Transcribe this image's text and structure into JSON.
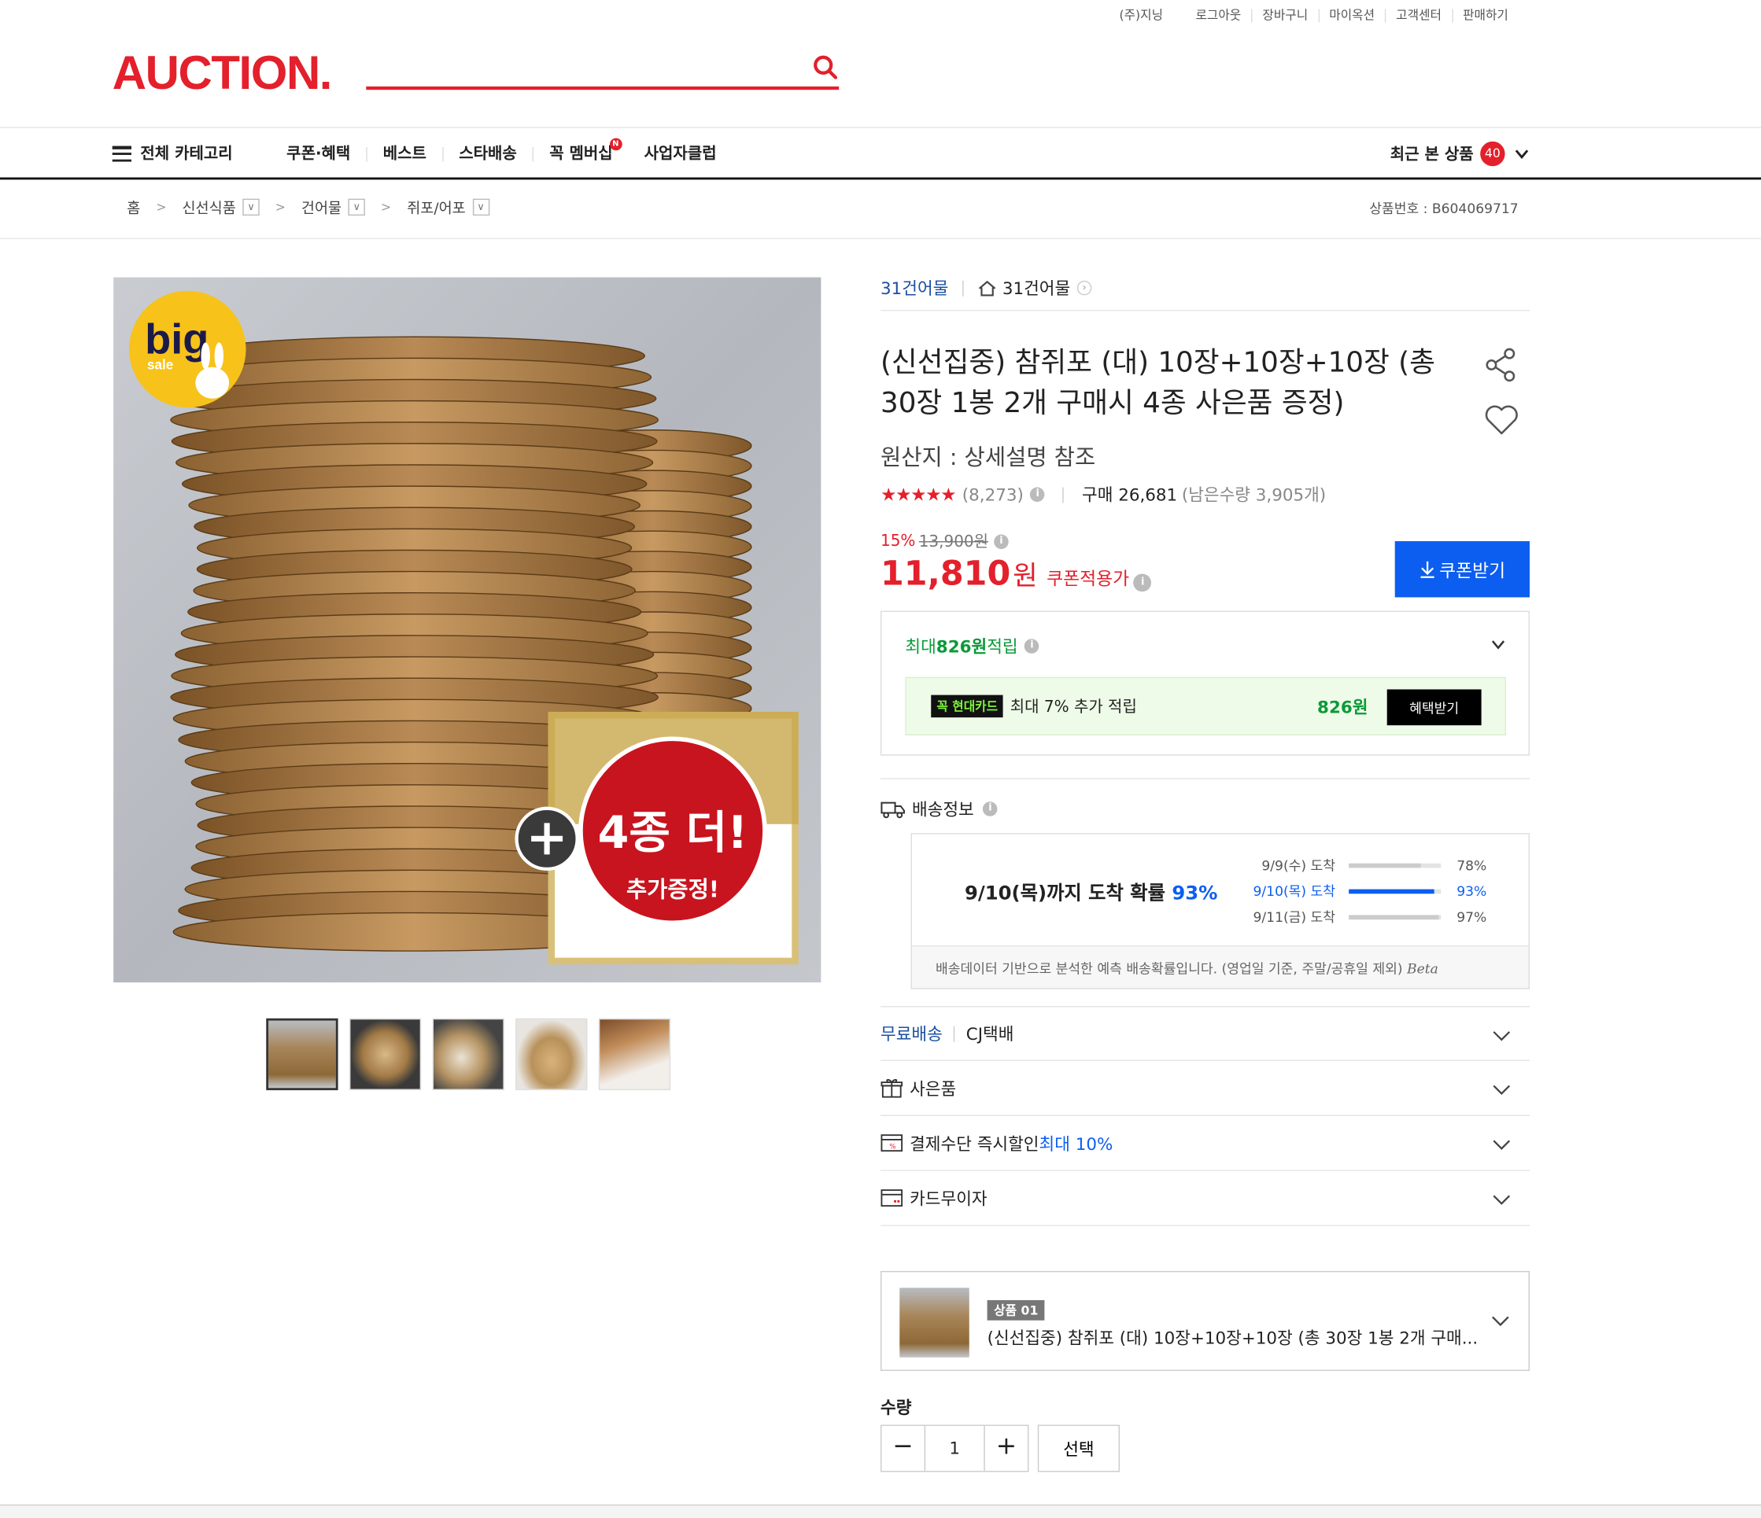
{
  "util_links": [
    "(주)지닝",
    "로그아웃",
    "장바구니",
    "마이옥션",
    "고객센터",
    "판매하기"
  ],
  "logo": "AUCTION.",
  "gnb": {
    "all_category": "전체 카테고리",
    "items": [
      "쿠폰·혜택",
      "베스트",
      "스타배송",
      "꼭 멤버십",
      "사업자클럽"
    ],
    "membership_badge": "N",
    "recent_label": "최근 본 상품",
    "recent_count": "40"
  },
  "breadcrumb": [
    "홈",
    "신선식품",
    "건어물",
    "쥐포/어포"
  ],
  "product_no": "상품번호 : B604069717",
  "seller": {
    "name": "31건어물",
    "store": "31건어물"
  },
  "product": {
    "title": "(신선집중) 참쥐포 (대) 10장+10장+10장 (총 30장 1봉 2개 구매시 4종 사은품 증정)",
    "origin": "원산지 : 상세설명 참조",
    "stars": "★★★★★",
    "review_count": "(8,273)",
    "purchase_label": "구매 26,681",
    "remaining": "(남은수량 3,905개)",
    "discount_pct": "15%",
    "original_price": "13,900원",
    "price": "11,810",
    "price_unit": "원",
    "price_label": "쿠폰적용가",
    "coupon_button": "쿠폰받기"
  },
  "image_badges": {
    "big": "big",
    "sale": "sale",
    "promo_main": "4종 더!",
    "promo_sub": "추가증정!"
  },
  "reward": {
    "prefix": "최대 ",
    "amount": "826원",
    "suffix": " 적립",
    "card_logo": "꼭 현대카드",
    "card_text": "최대 7% 추가 적립",
    "card_amount": "826원",
    "benefit_button": "혜택받기"
  },
  "shipping": {
    "title": "배송정보",
    "main_text": "9/10(목)까지 도착 확률 ",
    "main_pct": "93%",
    "probs": [
      {
        "date": "9/9(수) 도착",
        "pct": "78%",
        "value": 0.78
      },
      {
        "date": "9/10(목) 도착",
        "pct": "93%",
        "value": 0.93
      },
      {
        "date": "9/11(금) 도착",
        "pct": "97%",
        "value": 0.97
      }
    ],
    "note": "배송데이터 기반으로 분석한 예측 배송확률입니다. (영업일 기준, 주말/공휴일 제외) ",
    "beta": "Beta"
  },
  "accordion": {
    "free_shipping": "무료배송",
    "courier": "CJ택배",
    "gift": "사은품",
    "payment": "결제수단 즉시할인 ",
    "payment_max": "최대 10%",
    "installment": "카드무이자"
  },
  "option": {
    "badge": "상품 01",
    "name": "(신선집중) 참쥐포 (대) 10장+10장+10장 (총 30장 1봉 2개 구매..."
  },
  "quantity": {
    "label": "수량",
    "value": "1",
    "minus": "−",
    "plus": "+",
    "select": "선택"
  },
  "colors": {
    "accent": "#e3202b",
    "blue": "#0c5ef0",
    "green": "#0a9a37"
  }
}
